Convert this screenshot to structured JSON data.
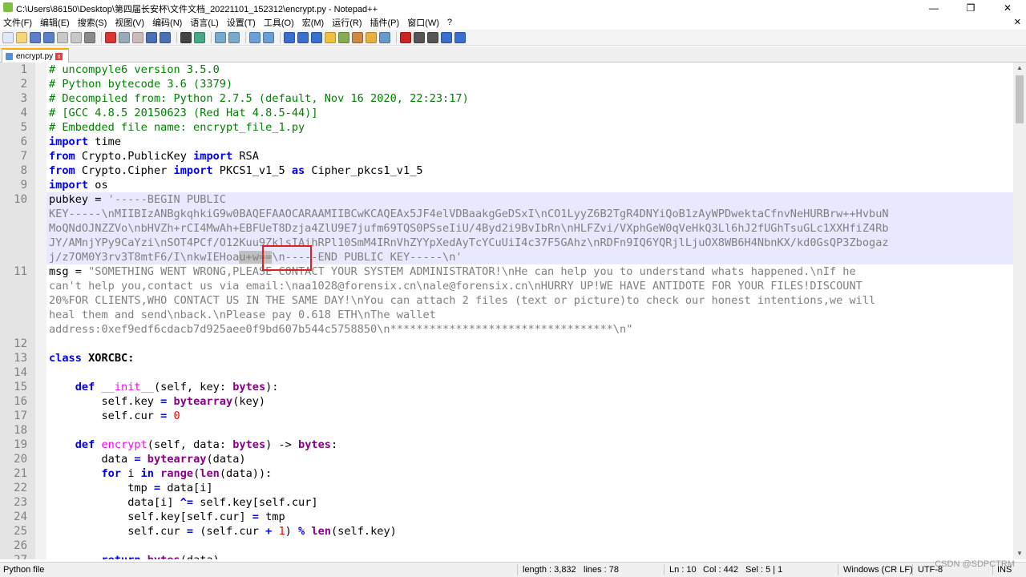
{
  "window": {
    "title": "C:\\Users\\86150\\Desktop\\第四届长安杯\\文件文档_20221101_152312\\encrypt.py - Notepad++",
    "minimize_label": "—",
    "maximize_label": "❐",
    "close_label": "✕"
  },
  "menu": {
    "items": [
      "文件(F)",
      "编辑(E)",
      "搜索(S)",
      "视图(V)",
      "编码(N)",
      "语言(L)",
      "设置(T)",
      "工具(O)",
      "宏(M)",
      "运行(R)",
      "插件(P)",
      "窗口(W)",
      "?"
    ],
    "close_label": "✕"
  },
  "tab": {
    "label": "encrypt.py",
    "close_label": "x"
  },
  "editor": {
    "lines": [
      {
        "num": "1",
        "segments": [
          {
            "t": "# uncompyle6 version 3.5.0",
            "c": "cmt"
          }
        ]
      },
      {
        "num": "2",
        "segments": [
          {
            "t": "# Python bytecode 3.6 (3379)",
            "c": "cmt"
          }
        ]
      },
      {
        "num": "3",
        "segments": [
          {
            "t": "# Decompiled from: Python 2.7.5 (default, Nov 16 2020, 22:23:17)",
            "c": "cmt"
          }
        ]
      },
      {
        "num": "4",
        "segments": [
          {
            "t": "# [GCC 4.8.5 20150623 (Red Hat 4.8.5-44)]",
            "c": "cmt"
          }
        ]
      },
      {
        "num": "5",
        "segments": [
          {
            "t": "# Embedded file name: encrypt_file_1.py",
            "c": "cmt"
          }
        ]
      },
      {
        "num": "6",
        "segments": [
          {
            "t": "import",
            "c": "kw"
          },
          {
            "t": " time",
            "c": ""
          }
        ]
      },
      {
        "num": "7",
        "segments": [
          {
            "t": "from",
            "c": "kw"
          },
          {
            "t": " Crypto.PublicKey ",
            "c": ""
          },
          {
            "t": "import",
            "c": "kw"
          },
          {
            "t": " RSA",
            "c": ""
          }
        ]
      },
      {
        "num": "8",
        "segments": [
          {
            "t": "from",
            "c": "kw"
          },
          {
            "t": " Crypto.Cipher ",
            "c": ""
          },
          {
            "t": "import",
            "c": "kw"
          },
          {
            "t": " PKCS1_v1_5 ",
            "c": ""
          },
          {
            "t": "as",
            "c": "kw"
          },
          {
            "t": " Cipher_pkcs1_v1_5",
            "c": ""
          }
        ]
      },
      {
        "num": "9",
        "segments": [
          {
            "t": "import",
            "c": "kw"
          },
          {
            "t": " os",
            "c": ""
          }
        ]
      },
      {
        "num": "10",
        "hl": true,
        "segments": [
          {
            "t": "pubkey = ",
            "c": ""
          },
          {
            "t": "'-----BEGIN PUBLIC",
            "c": "str"
          }
        ]
      },
      {
        "num": "",
        "hl": true,
        "segments": [
          {
            "t": "KEY-----\\nMIIBIzANBgkqhkiG9w0BAQEFAAOCARAAMIIBCwKCAQEAx5JF4elVDBaakgGeDSxI\\nCO1LyyZ6B2TgR4DNYiQoB1zAyWPDwektaCfnvNeHURBrw++HvbuN",
            "c": "str"
          }
        ]
      },
      {
        "num": "",
        "hl": true,
        "segments": [
          {
            "t": "MoQNdOJNZZVo\\nbHVZh+rCI4MwAh+EBFUeT8Dzja4ZlU9E7jufm69TQS0PSseIiU/4Byd2i9BvIbRn\\nHLFZvi/VXphGeW0qVeHkQ3Ll6hJ2fUGhTsuGLc1XXHfiZ4Rb",
            "c": "str"
          }
        ]
      },
      {
        "num": "",
        "hl": true,
        "segments": [
          {
            "t": "JY/AMnjYPy9CaYzi\\nSOT4PCf/O12Kuu9ZklsIAihRPl10SmM4IRnVhZYYpXedAyTcYCuUiI4c37F5GAhz\\nRDFn9IQ6YQRjlLjuOX8WB6H4NbnKX/kd0GsQP3Zbogaz",
            "c": "str"
          }
        ]
      },
      {
        "num": "",
        "hl": true,
        "segments": [
          {
            "t": "j/z7OM0Y3rv3T8mtF6/I\\nkwIEHoa",
            "c": "str"
          },
          {
            "t": "u+w==",
            "c": "str sel"
          },
          {
            "t": "\\n-----END PUBLIC KEY-----\\n'",
            "c": "str"
          }
        ]
      },
      {
        "num": "11",
        "segments": [
          {
            "t": "msg = ",
            "c": ""
          },
          {
            "t": "\"SOMETHING WENT WRONG,PLEASE CONTACT YOUR SYSTEM ADMINISTRATOR!\\nHe can help you to understand whats happened.\\nIf he",
            "c": "str"
          }
        ]
      },
      {
        "num": "",
        "segments": [
          {
            "t": "can't help you,contact us via email:\\naa1028@forensix.cn\\nale@forensix.cn\\nHURRY UP!WE HAVE ANTIDOTE FOR YOUR FILES!DISCOUNT",
            "c": "str"
          }
        ]
      },
      {
        "num": "",
        "segments": [
          {
            "t": "20%FOR CLIENTS,WHO CONTACT US IN THE SAME DAY!\\nYou can attach 2 files (text or picture)to check our honest intentions,we will",
            "c": "str"
          }
        ]
      },
      {
        "num": "",
        "segments": [
          {
            "t": "heal them and send\\nback.\\nPlease pay 0.618 ETH\\nThe wallet",
            "c": "str"
          }
        ]
      },
      {
        "num": "",
        "segments": [
          {
            "t": "address:0xef9edf6cdacb7d925aee0f9bd607b544c5758850\\n**********************************\\n\"",
            "c": "str"
          }
        ]
      },
      {
        "num": "12",
        "segments": []
      },
      {
        "num": "13",
        "segments": [
          {
            "t": "class",
            "c": "kw"
          },
          {
            "t": " XORCBC:",
            "c": "bold"
          }
        ]
      },
      {
        "num": "14",
        "segments": []
      },
      {
        "num": "15",
        "segments": [
          {
            "t": "    ",
            "c": ""
          },
          {
            "t": "def",
            "c": "kw"
          },
          {
            "t": " ",
            "c": ""
          },
          {
            "t": "__init__",
            "c": "fn"
          },
          {
            "t": "(self, key: ",
            "c": ""
          },
          {
            "t": "bytes",
            "c": "bi"
          },
          {
            "t": "):",
            "c": ""
          }
        ]
      },
      {
        "num": "16",
        "segments": [
          {
            "t": "        self.key ",
            "c": ""
          },
          {
            "t": "=",
            "c": "kw"
          },
          {
            "t": " ",
            "c": ""
          },
          {
            "t": "bytearray",
            "c": "bi"
          },
          {
            "t": "(key)",
            "c": ""
          }
        ]
      },
      {
        "num": "17",
        "segments": [
          {
            "t": "        self.cur ",
            "c": ""
          },
          {
            "t": "=",
            "c": "kw"
          },
          {
            "t": " ",
            "c": ""
          },
          {
            "t": "0",
            "c": "num"
          }
        ]
      },
      {
        "num": "18",
        "segments": []
      },
      {
        "num": "19",
        "segments": [
          {
            "t": "    ",
            "c": ""
          },
          {
            "t": "def",
            "c": "kw"
          },
          {
            "t": " ",
            "c": ""
          },
          {
            "t": "encrypt",
            "c": "fn"
          },
          {
            "t": "(self, data: ",
            "c": ""
          },
          {
            "t": "bytes",
            "c": "bi"
          },
          {
            "t": ") -> ",
            "c": ""
          },
          {
            "t": "bytes",
            "c": "bi"
          },
          {
            "t": ":",
            "c": ""
          }
        ]
      },
      {
        "num": "20",
        "segments": [
          {
            "t": "        data ",
            "c": ""
          },
          {
            "t": "=",
            "c": "kw"
          },
          {
            "t": " ",
            "c": ""
          },
          {
            "t": "bytearray",
            "c": "bi"
          },
          {
            "t": "(data)",
            "c": ""
          }
        ]
      },
      {
        "num": "21",
        "segments": [
          {
            "t": "        ",
            "c": ""
          },
          {
            "t": "for",
            "c": "kw"
          },
          {
            "t": " i ",
            "c": ""
          },
          {
            "t": "in",
            "c": "kw"
          },
          {
            "t": " ",
            "c": ""
          },
          {
            "t": "range",
            "c": "bi"
          },
          {
            "t": "(",
            "c": ""
          },
          {
            "t": "len",
            "c": "bi"
          },
          {
            "t": "(data)):",
            "c": ""
          }
        ]
      },
      {
        "num": "22",
        "segments": [
          {
            "t": "            tmp ",
            "c": ""
          },
          {
            "t": "=",
            "c": "kw"
          },
          {
            "t": " data[i]",
            "c": ""
          }
        ]
      },
      {
        "num": "23",
        "segments": [
          {
            "t": "            data[i] ",
            "c": ""
          },
          {
            "t": "^=",
            "c": "kw"
          },
          {
            "t": " self.key[self.cur]",
            "c": ""
          }
        ]
      },
      {
        "num": "24",
        "segments": [
          {
            "t": "            self.key[self.cur] ",
            "c": ""
          },
          {
            "t": "=",
            "c": "kw"
          },
          {
            "t": " tmp",
            "c": ""
          }
        ]
      },
      {
        "num": "25",
        "segments": [
          {
            "t": "            self.cur ",
            "c": ""
          },
          {
            "t": "=",
            "c": "kw"
          },
          {
            "t": " (self.cur ",
            "c": ""
          },
          {
            "t": "+",
            "c": "kw"
          },
          {
            "t": " ",
            "c": ""
          },
          {
            "t": "1",
            "c": "num"
          },
          {
            "t": ") ",
            "c": ""
          },
          {
            "t": "%",
            "c": "kw"
          },
          {
            "t": " ",
            "c": ""
          },
          {
            "t": "len",
            "c": "bi"
          },
          {
            "t": "(self.key)",
            "c": ""
          }
        ]
      },
      {
        "num": "26",
        "segments": []
      },
      {
        "num": "27",
        "segments": [
          {
            "t": "        ",
            "c": ""
          },
          {
            "t": "return",
            "c": "kw"
          },
          {
            "t": " ",
            "c": ""
          },
          {
            "t": "bytes",
            "c": "bi"
          },
          {
            "t": "(data)",
            "c": ""
          }
        ]
      }
    ]
  },
  "status": {
    "file_type": "Python file",
    "length": "length : 3,832",
    "lines": "lines : 78",
    "ln": "Ln : 10",
    "col": "Col : 442",
    "sel": "Sel : 5 | 1",
    "eol": "Windows (CR LF)",
    "encoding": "UTF-8",
    "mode": "INS"
  },
  "watermark": "CSDN @SDPCTRM",
  "colors": {
    "comment": "#008000",
    "keyword": "#0000ff",
    "string": "#808080",
    "number": "#ff0000",
    "function": "#ff00ff",
    "builtin": "#880088",
    "current_line": "#e8e8ff",
    "annotation_box": "#e02020"
  },
  "toolbar_icons": [
    "new-file-icon",
    "open-file-icon",
    "save-icon",
    "save-all-icon",
    "close-icon",
    "close-all-icon",
    "print-icon",
    "cut-icon",
    "copy-icon",
    "paste-icon",
    "undo-icon",
    "redo-icon",
    "find-icon",
    "replace-icon",
    "zoom-in-icon",
    "zoom-out-icon",
    "sync-v-icon",
    "sync-h-icon",
    "word-wrap-icon",
    "show-all-chars-icon",
    "indent-guide-icon",
    "lang-icon",
    "doc-map-icon",
    "function-list-icon",
    "folder-workspace-icon",
    "monitor-icon",
    "record-macro-icon",
    "stop-macro-icon",
    "play-macro-icon",
    "run-macro-icon",
    "save-macro-icon"
  ]
}
